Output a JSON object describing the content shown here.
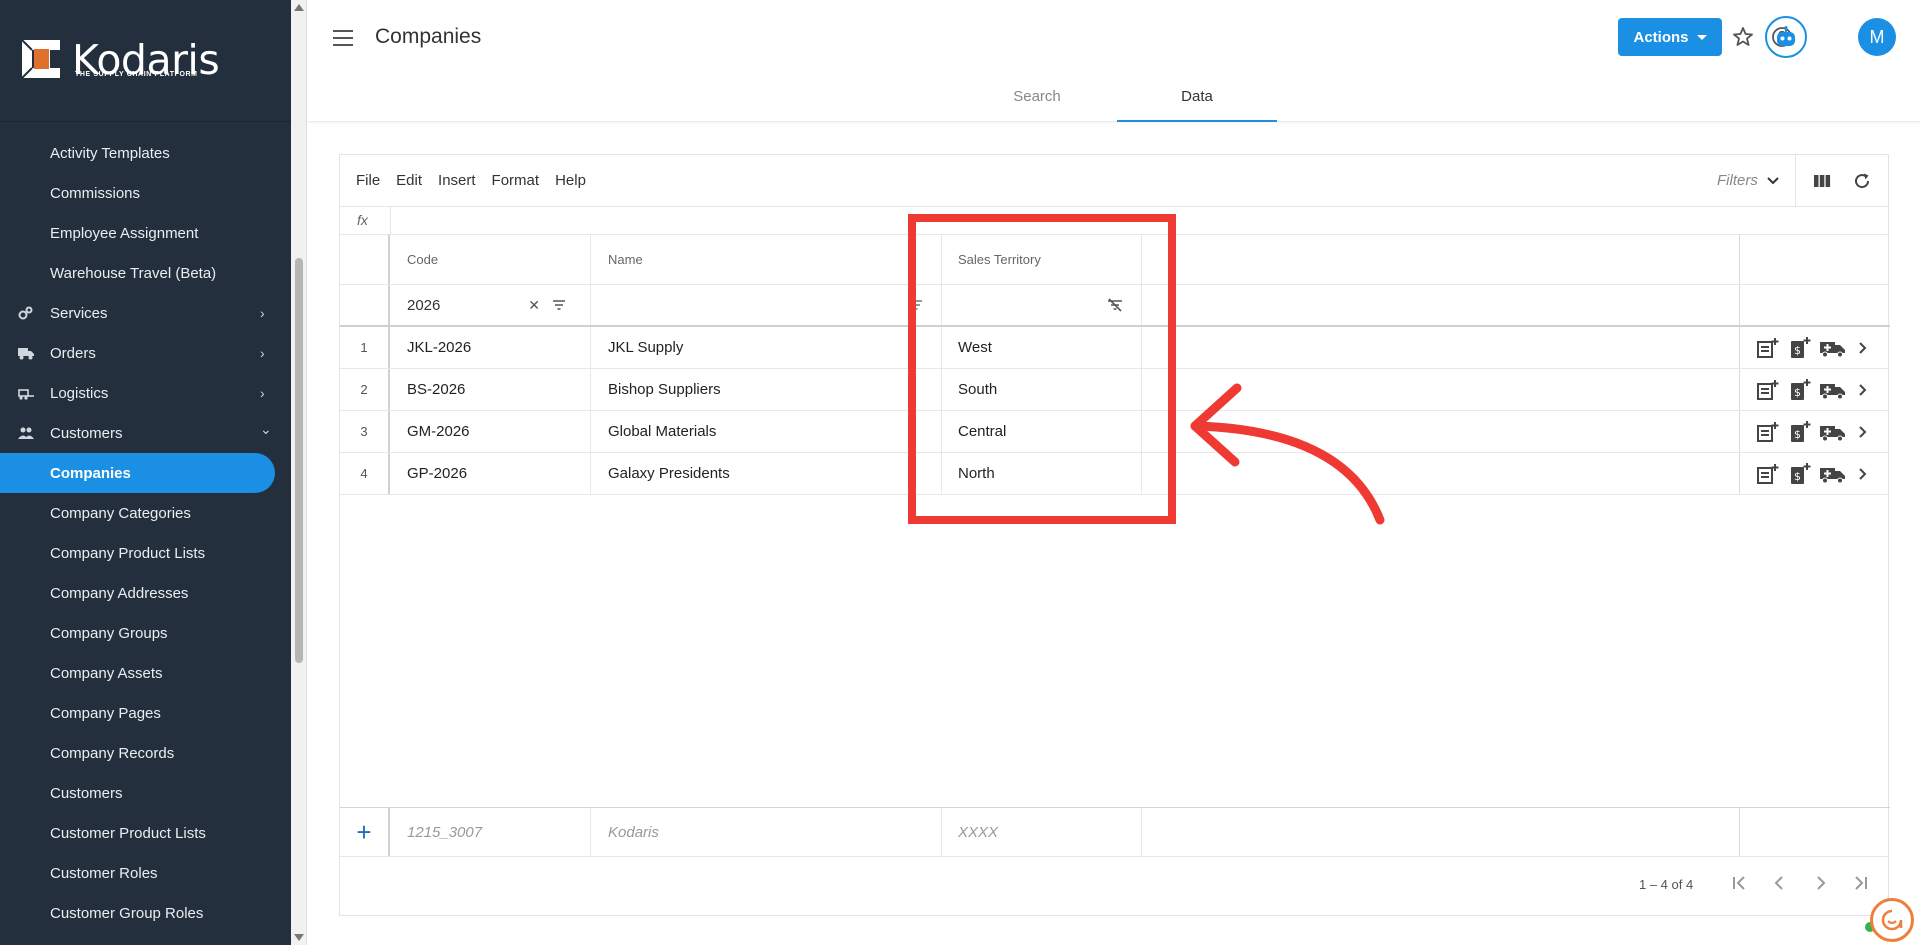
{
  "brand": {
    "name": "Kodaris",
    "tagline": "THE SUPPLY CHAIN PLATFORM",
    "accent": "#1a8fe3",
    "sidebar_bg": "#232f3c",
    "annotation": "#ee3a33"
  },
  "sidebar": {
    "items": [
      {
        "label": "Activity Templates"
      },
      {
        "label": "Commissions"
      },
      {
        "label": "Employee Assignment"
      },
      {
        "label": "Warehouse Travel (Beta)"
      },
      {
        "label": "Services",
        "icon": "gears-icon",
        "chevron": "›"
      },
      {
        "label": "Orders",
        "icon": "truck-icon",
        "chevron": "›"
      },
      {
        "label": "Logistics",
        "icon": "forklift-icon",
        "chevron": "›"
      },
      {
        "label": "Customers",
        "icon": "people-icon",
        "chevron": "⌄"
      },
      {
        "label": "Companies",
        "active": true
      },
      {
        "label": "Company Categories"
      },
      {
        "label": "Company Product Lists"
      },
      {
        "label": "Company Addresses"
      },
      {
        "label": "Company Groups"
      },
      {
        "label": "Company Assets"
      },
      {
        "label": "Company Pages"
      },
      {
        "label": "Company Records"
      },
      {
        "label": "Customers"
      },
      {
        "label": "Customer Product Lists"
      },
      {
        "label": "Customer Roles"
      },
      {
        "label": "Customer Group Roles"
      }
    ]
  },
  "header": {
    "title": "Companies",
    "actions_label": "Actions",
    "avatar_initial": "M",
    "tabs": [
      {
        "label": "Search"
      },
      {
        "label": "Data",
        "active": true
      }
    ]
  },
  "toolbar": {
    "menu": [
      "File",
      "Edit",
      "Insert",
      "Format",
      "Help"
    ],
    "filters_label": "Filters",
    "fx_label": "fx"
  },
  "grid": {
    "columns": {
      "code": "Code",
      "name": "Name",
      "territory": "Sales Territory"
    },
    "filter_values": {
      "code": "2026",
      "name": "",
      "territory": ""
    },
    "rows": [
      {
        "num": "1",
        "code": "JKL-2026",
        "name": "JKL Supply",
        "territory": "West"
      },
      {
        "num": "2",
        "code": "BS-2026",
        "name": "Bishop Suppliers",
        "territory": "South"
      },
      {
        "num": "3",
        "code": "GM-2026",
        "name": "Global Materials",
        "territory": "Central"
      },
      {
        "num": "4",
        "code": "GP-2026",
        "name": "Galaxy Presidents",
        "territory": "North"
      }
    ],
    "new_row": {
      "plus": "+",
      "code": "1215_3007",
      "name": "Kodaris",
      "territory": "XXXX"
    },
    "pager_info": "1 – 4 of 4"
  }
}
